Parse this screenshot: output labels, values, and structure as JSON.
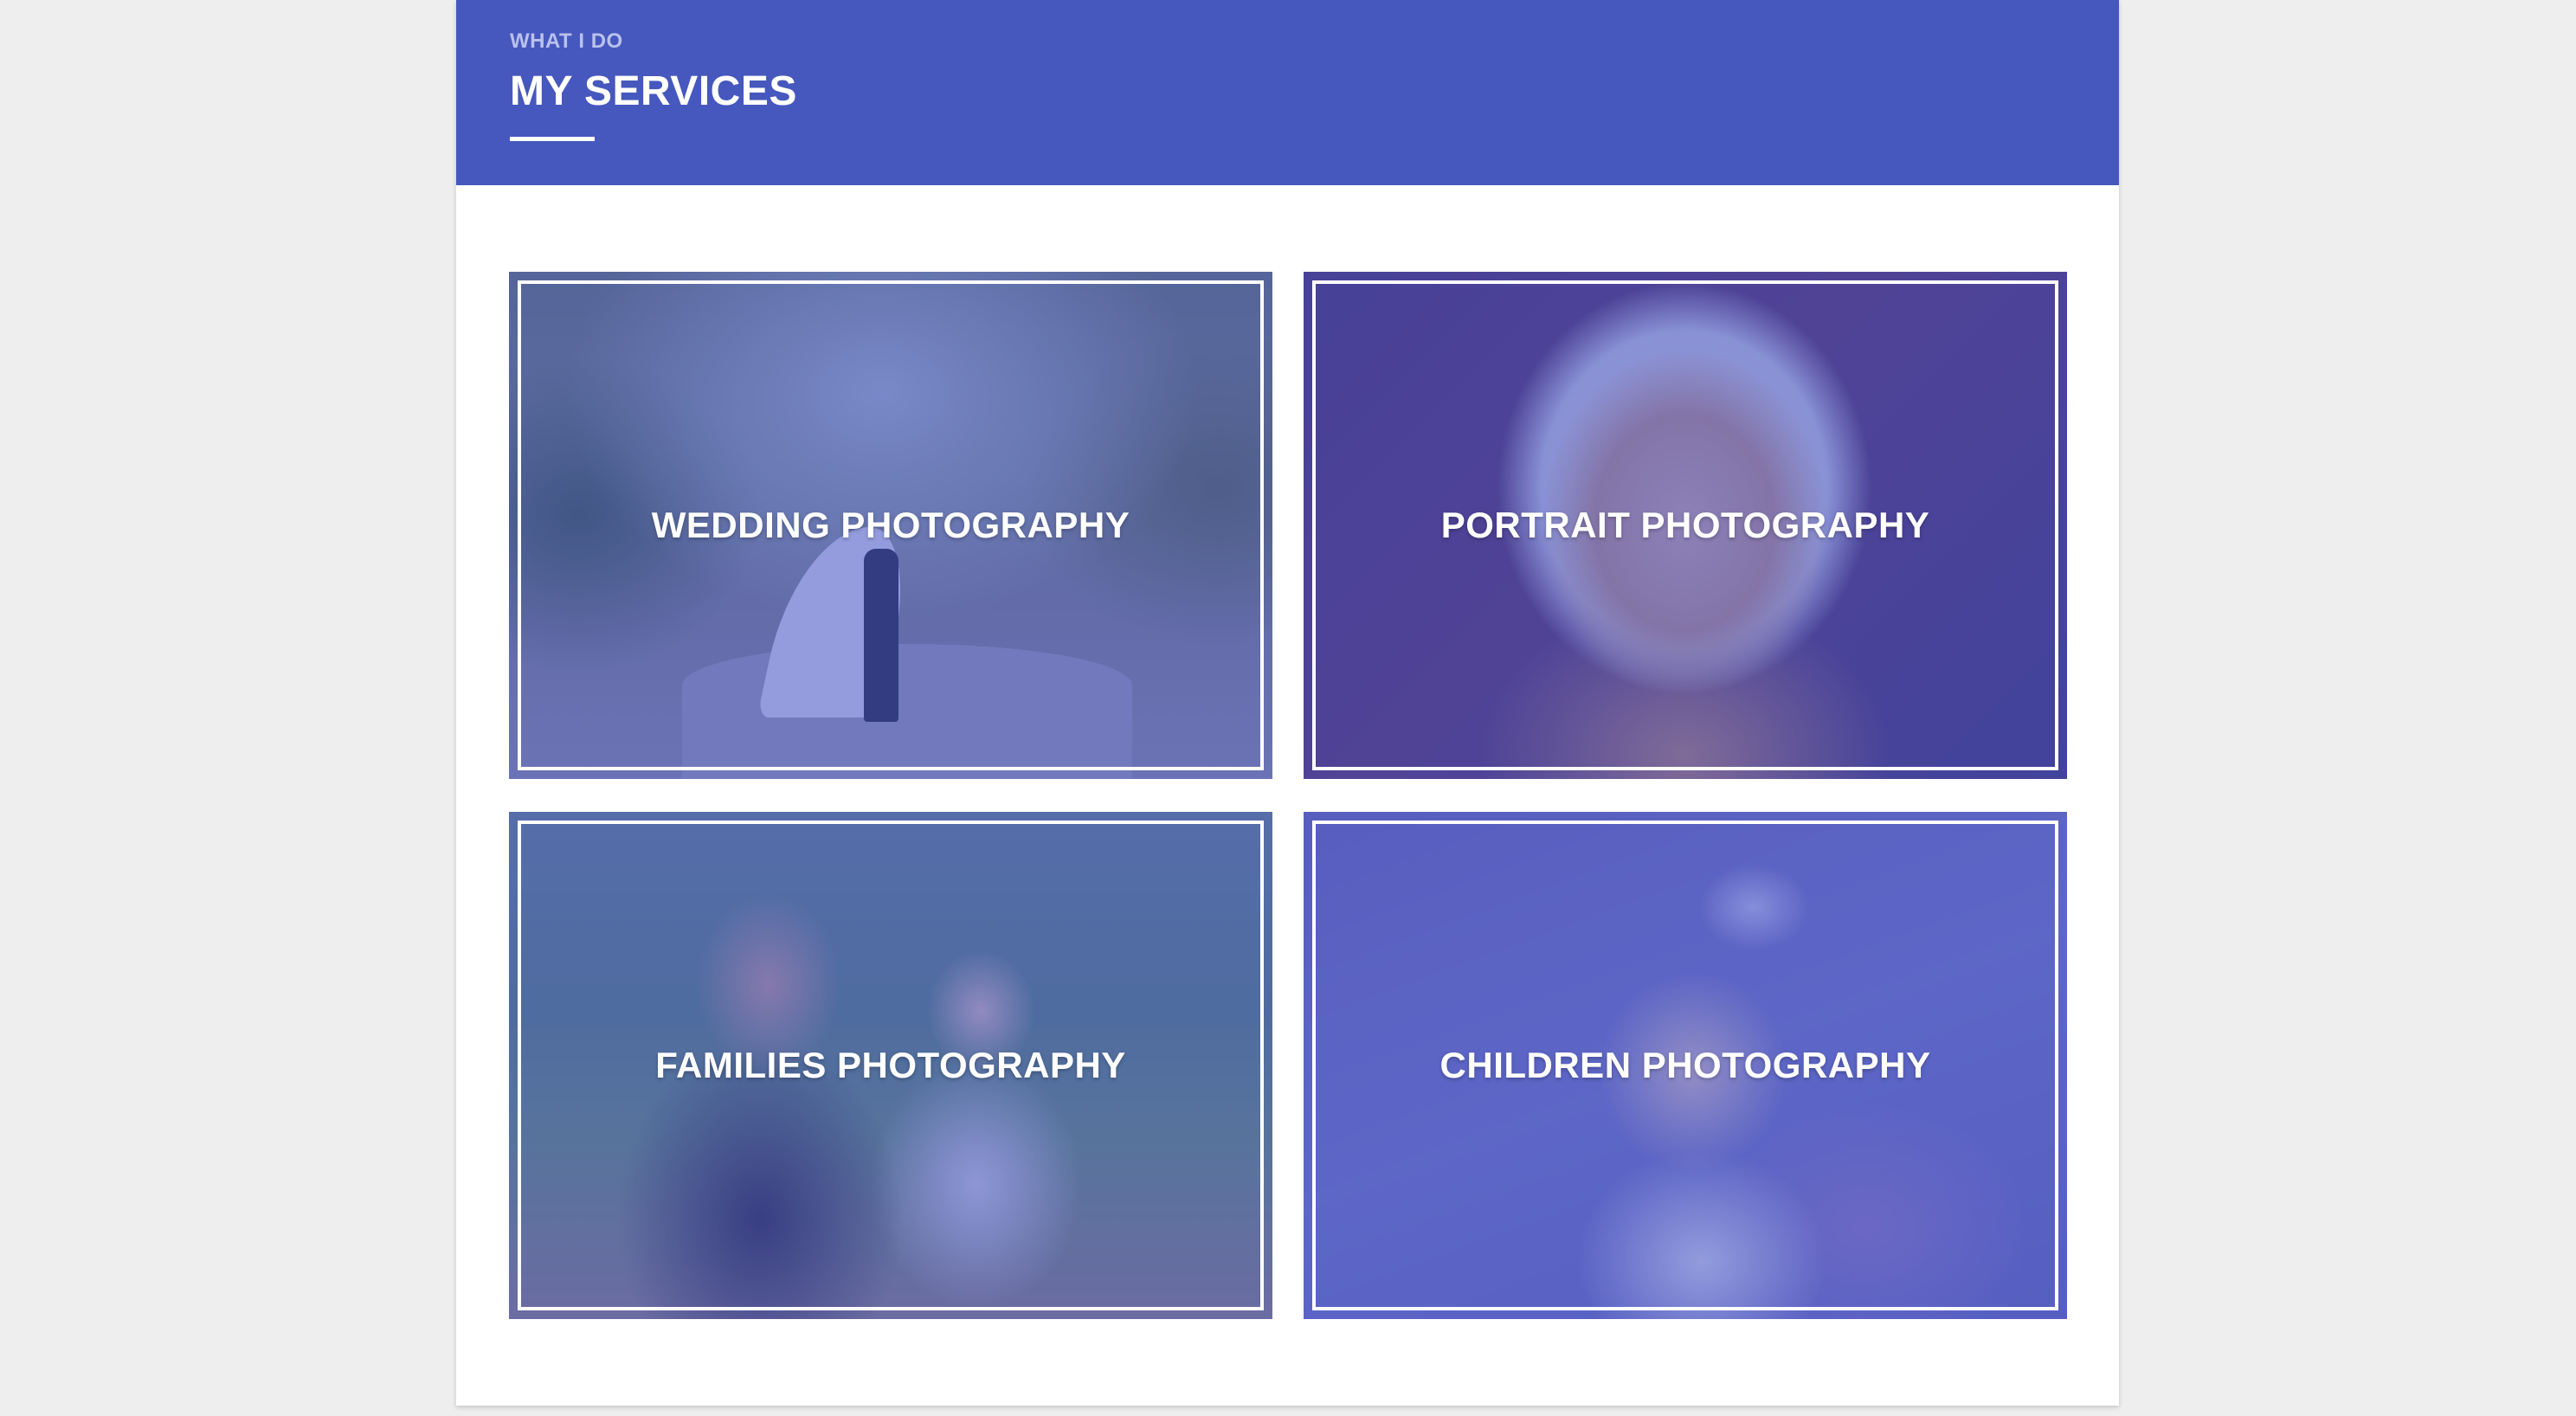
{
  "section": {
    "eyebrow": "WHAT I DO",
    "title": "MY SERVICES"
  },
  "services": [
    {
      "label": "WEDDING PHOTOGRAPHY"
    },
    {
      "label": "PORTRAIT PHOTOGRAPHY"
    },
    {
      "label": "FAMILIES PHOTOGRAPHY"
    },
    {
      "label": "CHILDREN PHOTOGRAPHY"
    }
  ],
  "colors": {
    "header_bg": "#4658bd",
    "page_bg": "#eeeeee",
    "card_bg": "#ffffff",
    "tile_tint": "#4654c8",
    "text_light": "#ffffff"
  }
}
